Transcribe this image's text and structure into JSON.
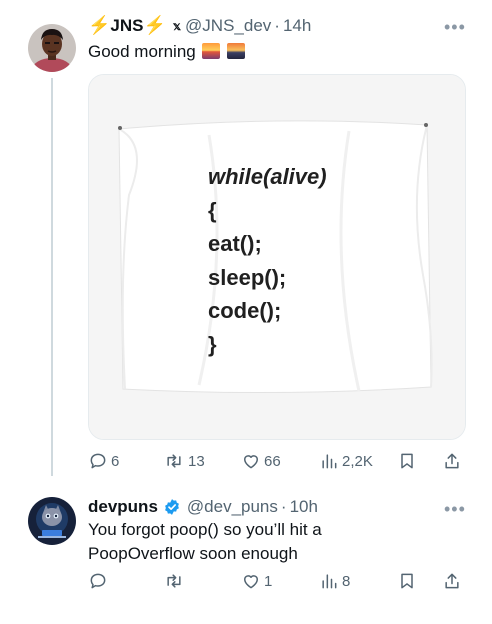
{
  "tweets": [
    {
      "author": {
        "name": "JNS",
        "bolt": "⚡",
        "x_mark": "𝕩",
        "handle": "@JNS_dev",
        "separator": "·",
        "time": "14h"
      },
      "text": "Good morning",
      "media": {
        "code_lines": [
          "while(alive)",
          "{",
          "eat();",
          "sleep();",
          "code();",
          "}"
        ]
      },
      "stats": {
        "replies": "6",
        "reposts": "13",
        "likes": "66",
        "views": "2,2K"
      }
    },
    {
      "author": {
        "name": "devpuns",
        "handle": "@dev_puns",
        "separator": "·",
        "time": "10h"
      },
      "text_line_1": "You forgot poop() so you’ll hit a",
      "text_line_2": "PoopOverflow soon enough",
      "stats": {
        "replies": "",
        "reposts": "",
        "likes": "1",
        "views": "8"
      }
    }
  ],
  "icons": {
    "more": "more-dots-icon",
    "reply": "reply-icon",
    "repost": "repost-icon",
    "like": "heart-icon",
    "views": "views-chart-icon",
    "bookmark": "bookmark-icon",
    "share": "share-icon",
    "verified": "verified-badge-icon"
  },
  "colors": {
    "text_primary": "#0f1419",
    "text_secondary": "#536471",
    "verified_blue": "#1d9bf0",
    "bolt": "#f5b400",
    "thread_line": "#cfd9de"
  }
}
